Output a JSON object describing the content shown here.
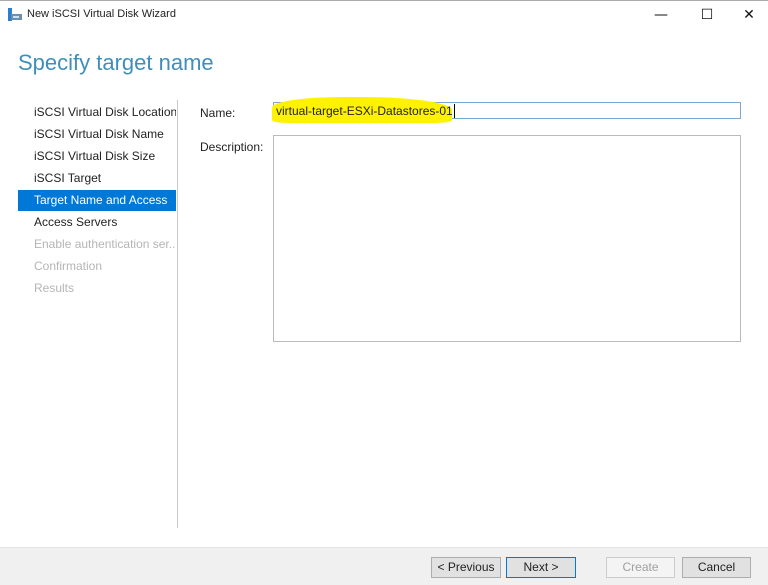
{
  "window": {
    "title": "New iSCSI Virtual Disk Wizard",
    "icon": "iscsi-disk-icon",
    "controls": {
      "minimize": "—",
      "maximize": "☐",
      "close": "✕"
    }
  },
  "heading": "Specify target name",
  "nav": {
    "items": [
      {
        "label": "iSCSI Virtual Disk Location",
        "state": "normal"
      },
      {
        "label": "iSCSI Virtual Disk Name",
        "state": "normal"
      },
      {
        "label": "iSCSI Virtual Disk Size",
        "state": "normal"
      },
      {
        "label": "iSCSI Target",
        "state": "normal"
      },
      {
        "label": "Target Name and Access",
        "state": "active"
      },
      {
        "label": "Access Servers",
        "state": "normal"
      },
      {
        "label": "Enable authentication ser...",
        "state": "disabled"
      },
      {
        "label": "Confirmation",
        "state": "disabled"
      },
      {
        "label": "Results",
        "state": "disabled"
      }
    ]
  },
  "form": {
    "name_label": "Name:",
    "name_value": "virtual-target-ESXi-Datastores-01",
    "description_label": "Description:",
    "description_value": ""
  },
  "buttons": {
    "previous": "< Previous",
    "next": "Next >",
    "create": "Create",
    "cancel": "Cancel"
  },
  "colors": {
    "accent": "#0078d7",
    "heading": "#3f8fba",
    "highlight": "#fff200"
  }
}
